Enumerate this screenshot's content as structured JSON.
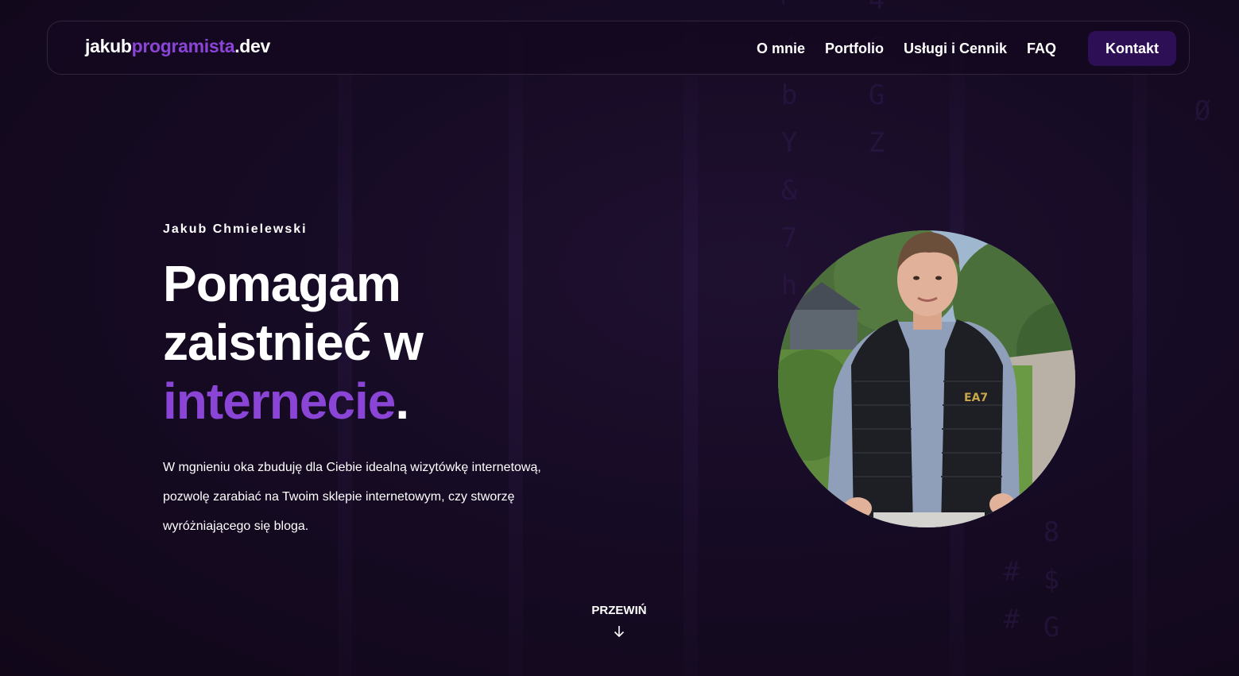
{
  "brand": {
    "logo_part1": "jakub",
    "logo_part2": "programista",
    "logo_part3": ".dev",
    "accent_color": "#8b45d6",
    "button_color": "#2c0f55",
    "background_color": "#150a21"
  },
  "nav": {
    "items": [
      {
        "label": "O mnie"
      },
      {
        "label": "Portfolio"
      },
      {
        "label": "Usługi i Cennik"
      },
      {
        "label": "FAQ"
      }
    ],
    "cta_label": "Kontakt"
  },
  "hero": {
    "eyebrow": "Jakub Chmielewski",
    "headline_line1": "Pomagam",
    "headline_line2": "zaistnieć w",
    "headline_accent": "internecie",
    "headline_end": ".",
    "lead": "W mgnieniu oka zbuduję dla Ciebie idealną wizytówkę internetową, pozwolę zarabiać na Twoim sklepie internetowym, czy stworzę wyróżniającego się bloga."
  },
  "scroll": {
    "label": "PRZEWIŃ",
    "icon": "arrow-down-icon"
  },
  "portrait": {
    "icon": "person-photo"
  }
}
